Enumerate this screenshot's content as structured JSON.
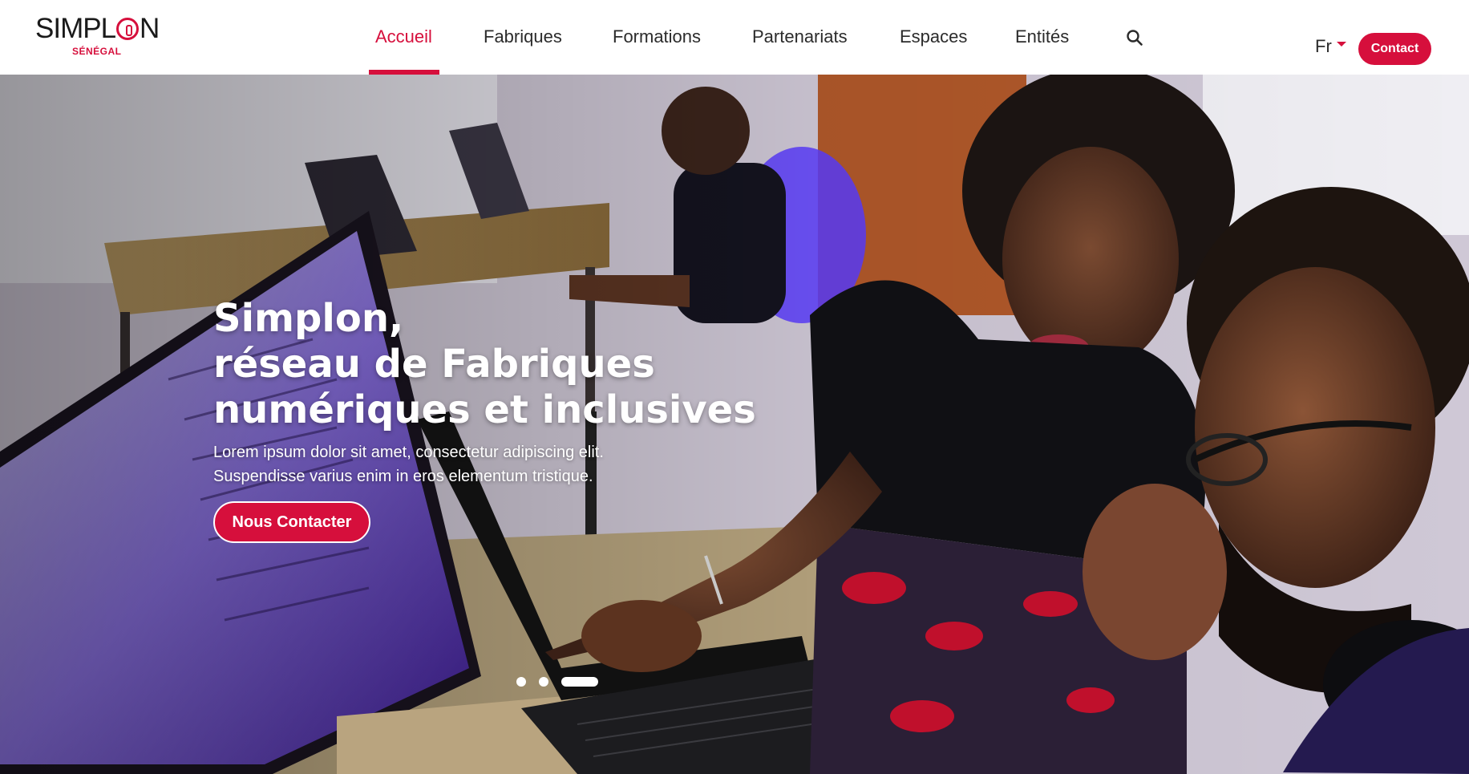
{
  "brand": {
    "name_left": "SIMPL",
    "name_right": "N",
    "subtitle": "SÉNÉGAL",
    "accent": "#d60f3c"
  },
  "nav": {
    "items": [
      {
        "label": "Accueil",
        "active": true
      },
      {
        "label": "Fabriques",
        "active": false
      },
      {
        "label": "Formations",
        "active": false
      },
      {
        "label": "Partenariats",
        "active": false
      },
      {
        "label": "Espaces",
        "active": false
      },
      {
        "label": "Entités",
        "active": false
      }
    ],
    "search_icon": "search-icon"
  },
  "header_right": {
    "language": "Fr",
    "contact_label": "Contact"
  },
  "hero": {
    "title_lines": [
      "Simplon,",
      "réseau de Fabriques",
      "numériques et inclusives"
    ],
    "description_lines": [
      "Lorem ipsum dolor sit amet, consectetur adipiscing elit.",
      "Suspendisse varius enim in eros elementum tristique."
    ],
    "cta_label": "Nous Contacter",
    "slides": 3,
    "active_slide": 3
  }
}
